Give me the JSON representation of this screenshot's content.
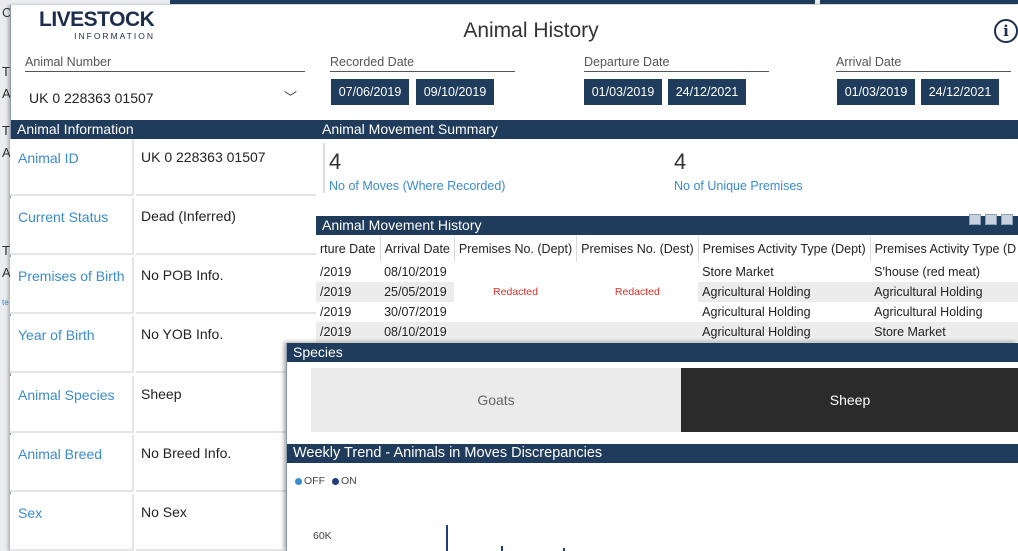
{
  "background": {
    "letters": [
      "C",
      "T",
      "A",
      "T",
      "A",
      "T",
      "A",
      "te"
    ]
  },
  "header": {
    "logo_main": "LIVESTOCK",
    "logo_sub": "INFORMATION",
    "title": "Animal History",
    "info_glyph": "i"
  },
  "filters": {
    "animal_number": {
      "label": "Animal Number",
      "value": "UK 0 228363 01507",
      "chevron": "﹀"
    },
    "recorded_date": {
      "label": "Recorded Date",
      "start": "07/06/2019",
      "end": "09/10/2019"
    },
    "departure_date": {
      "label": "Departure Date",
      "start": "01/03/2019",
      "end": "24/12/2021"
    },
    "arrival_date": {
      "label": "Arrival Date",
      "start": "01/03/2019",
      "end": "24/12/2021"
    }
  },
  "animal_info": {
    "title": "Animal Information",
    "rows": [
      {
        "key": "Animal ID",
        "value": "UK 0 228363 01507"
      },
      {
        "key": "Current Status",
        "value": "Dead (Inferred)"
      },
      {
        "key": "Premises of Birth",
        "value": "No POB Info."
      },
      {
        "key": "Year of Birth",
        "value": "No YOB Info."
      },
      {
        "key": "Animal Species",
        "value": "Sheep"
      },
      {
        "key": "Animal Breed",
        "value": "No Breed Info."
      },
      {
        "key": "Sex",
        "value": "No Sex"
      }
    ]
  },
  "summary": {
    "title": "Animal Movement Summary",
    "moves": {
      "value": "4",
      "label": "No of Moves (Where Recorded)"
    },
    "premises": {
      "value": "4",
      "label": "No of Unique Premises"
    }
  },
  "history": {
    "title": "Animal Movement History",
    "columns": [
      "rture Date",
      "Arrival Date",
      "Premises No. (Dept)",
      "Premises No. (Dest)",
      "Premises Activity Type (Dept)",
      "Premises Activity Type (D"
    ],
    "redacted_label": "Redacted",
    "rows": [
      {
        "dept": "/2019",
        "arr": "08/10/2019",
        "type_dept": "Store Market",
        "type_dest": "S'house (red meat)"
      },
      {
        "dept": "/2019",
        "arr": "25/05/2019",
        "type_dept": "Agricultural Holding",
        "type_dest": "Agricultural Holding"
      },
      {
        "dept": "/2019",
        "arr": "30/07/2019",
        "type_dept": "Agricultural Holding",
        "type_dest": "Agricultural Holding"
      },
      {
        "dept": "/2019",
        "arr": "08/10/2019",
        "type_dept": "Agricultural Holding",
        "type_dest": "Store Market"
      }
    ]
  },
  "species": {
    "title": "Species",
    "options": [
      {
        "label": "Goats",
        "selected": false
      },
      {
        "label": "Sheep",
        "selected": true
      }
    ]
  },
  "weekly_trend": {
    "title": "Weekly Trend - Animals in Moves Discrepancies",
    "legend": [
      {
        "label": "OFF",
        "color": "#3a8ccf"
      },
      {
        "label": "ON",
        "color": "#1f3c7c"
      }
    ],
    "y_tick": "60K"
  },
  "colors": {
    "header_bar": "#1f3c5c",
    "link": "#3a8ccf",
    "selected": "#2b2b2b",
    "unselected": "#ebebeb",
    "redacted": "#e0302a"
  }
}
